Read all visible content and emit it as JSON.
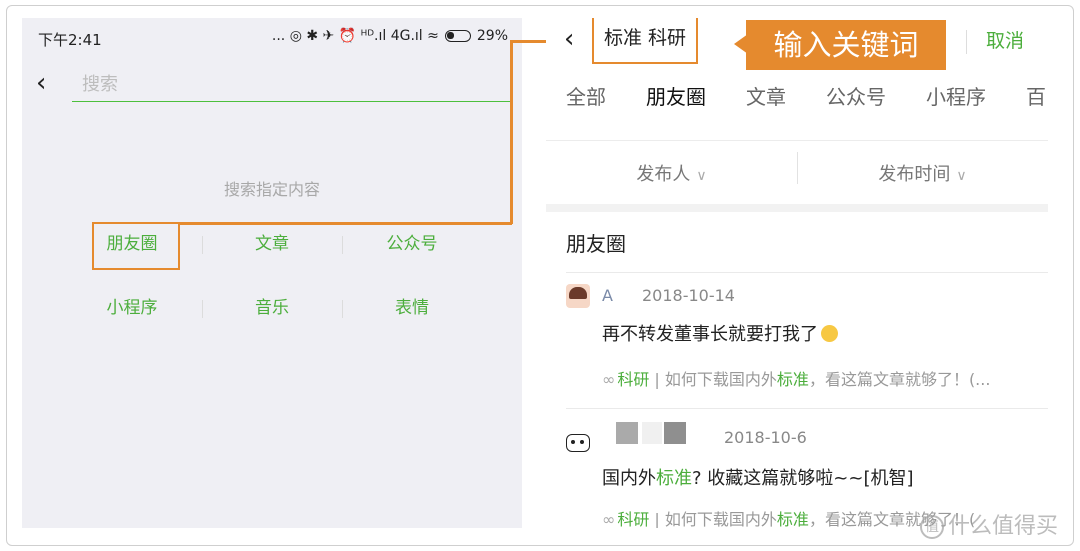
{
  "left": {
    "status": {
      "time": "下午2:41",
      "icons_text": "... ◎ ✱ ✈ ⏰ ᴴᴰ.ıl 4G.ıl ≈",
      "battery": "29%"
    },
    "search_placeholder": "搜索",
    "hint": "搜索指定内容",
    "categories_row1": [
      "朋友圈",
      "文章",
      "公众号"
    ],
    "categories_row2": [
      "小程序",
      "音乐",
      "表情"
    ]
  },
  "right": {
    "query": "标准 科研",
    "callout": "输入关键词",
    "cancel": "取消",
    "tabs": [
      "全部",
      "朋友圈",
      "文章",
      "公众号",
      "小程序",
      "百"
    ],
    "filters": [
      "发布人",
      "发布时间"
    ],
    "section_title": "朋友圈",
    "posts": [
      {
        "author": "A",
        "date": "2018-10-14",
        "text": "再不转发董事长就要打我了",
        "link_prefix": "科研",
        "link_mid": " | 如何下载国内外",
        "link_hl": "标准",
        "link_suffix": "，看这篇文章就够了！(..."
      },
      {
        "author": "",
        "date": "2018-10-6",
        "text_pre": "国内外",
        "text_hl": "标准",
        "text_post": "? 收藏这篇就够啦~~[机智]",
        "link_prefix": "科研",
        "link_mid": " | 如何下载国内外",
        "link_hl": "标准",
        "link_suffix": "，看这篇文章就够了！("
      }
    ]
  },
  "watermark": "什么值得买",
  "colors": {
    "accent": "#e58a2e",
    "green": "#4cae3c"
  }
}
